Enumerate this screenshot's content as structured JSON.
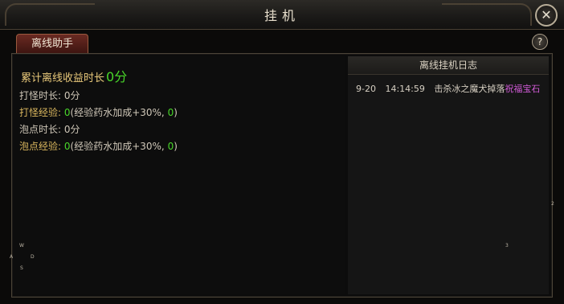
{
  "window": {
    "title": "挂机",
    "close_glyph": "✕"
  },
  "tab": {
    "label": "离线助手"
  },
  "help": {
    "glyph": "?"
  },
  "summary": {
    "label": "累计离线收益时长",
    "value": "0分"
  },
  "stats": [
    {
      "label": "打怪时长:",
      "value": "0分"
    },
    {
      "label": "打怪经验:",
      "value": "0",
      "detail": "(经验药水加成+30%,",
      "bonus": "0",
      "tail": ")"
    },
    {
      "label": "泡点时长:",
      "value": "0分"
    },
    {
      "label": "泡点经验:",
      "value": "0",
      "detail": "(经验药水加成+30%,",
      "bonus": "0",
      "tail": ")"
    }
  ],
  "log": {
    "title": "离线挂机日志",
    "entries": [
      {
        "date": "9-20",
        "time": "14:14:59",
        "text": "击杀冰之魔犬掉落",
        "item": "祝福宝石",
        "item_color": "#d25bd8"
      }
    ]
  },
  "stray": {
    "w": "W",
    "a": "A",
    "d": "D",
    "s": "S",
    "n2": "2",
    "n3": "3"
  },
  "colors": {
    "accent_green": "#49d72a",
    "gold": "#d9b65e",
    "item_purple": "#d25bd8",
    "tab_red": "#6a2a22"
  }
}
